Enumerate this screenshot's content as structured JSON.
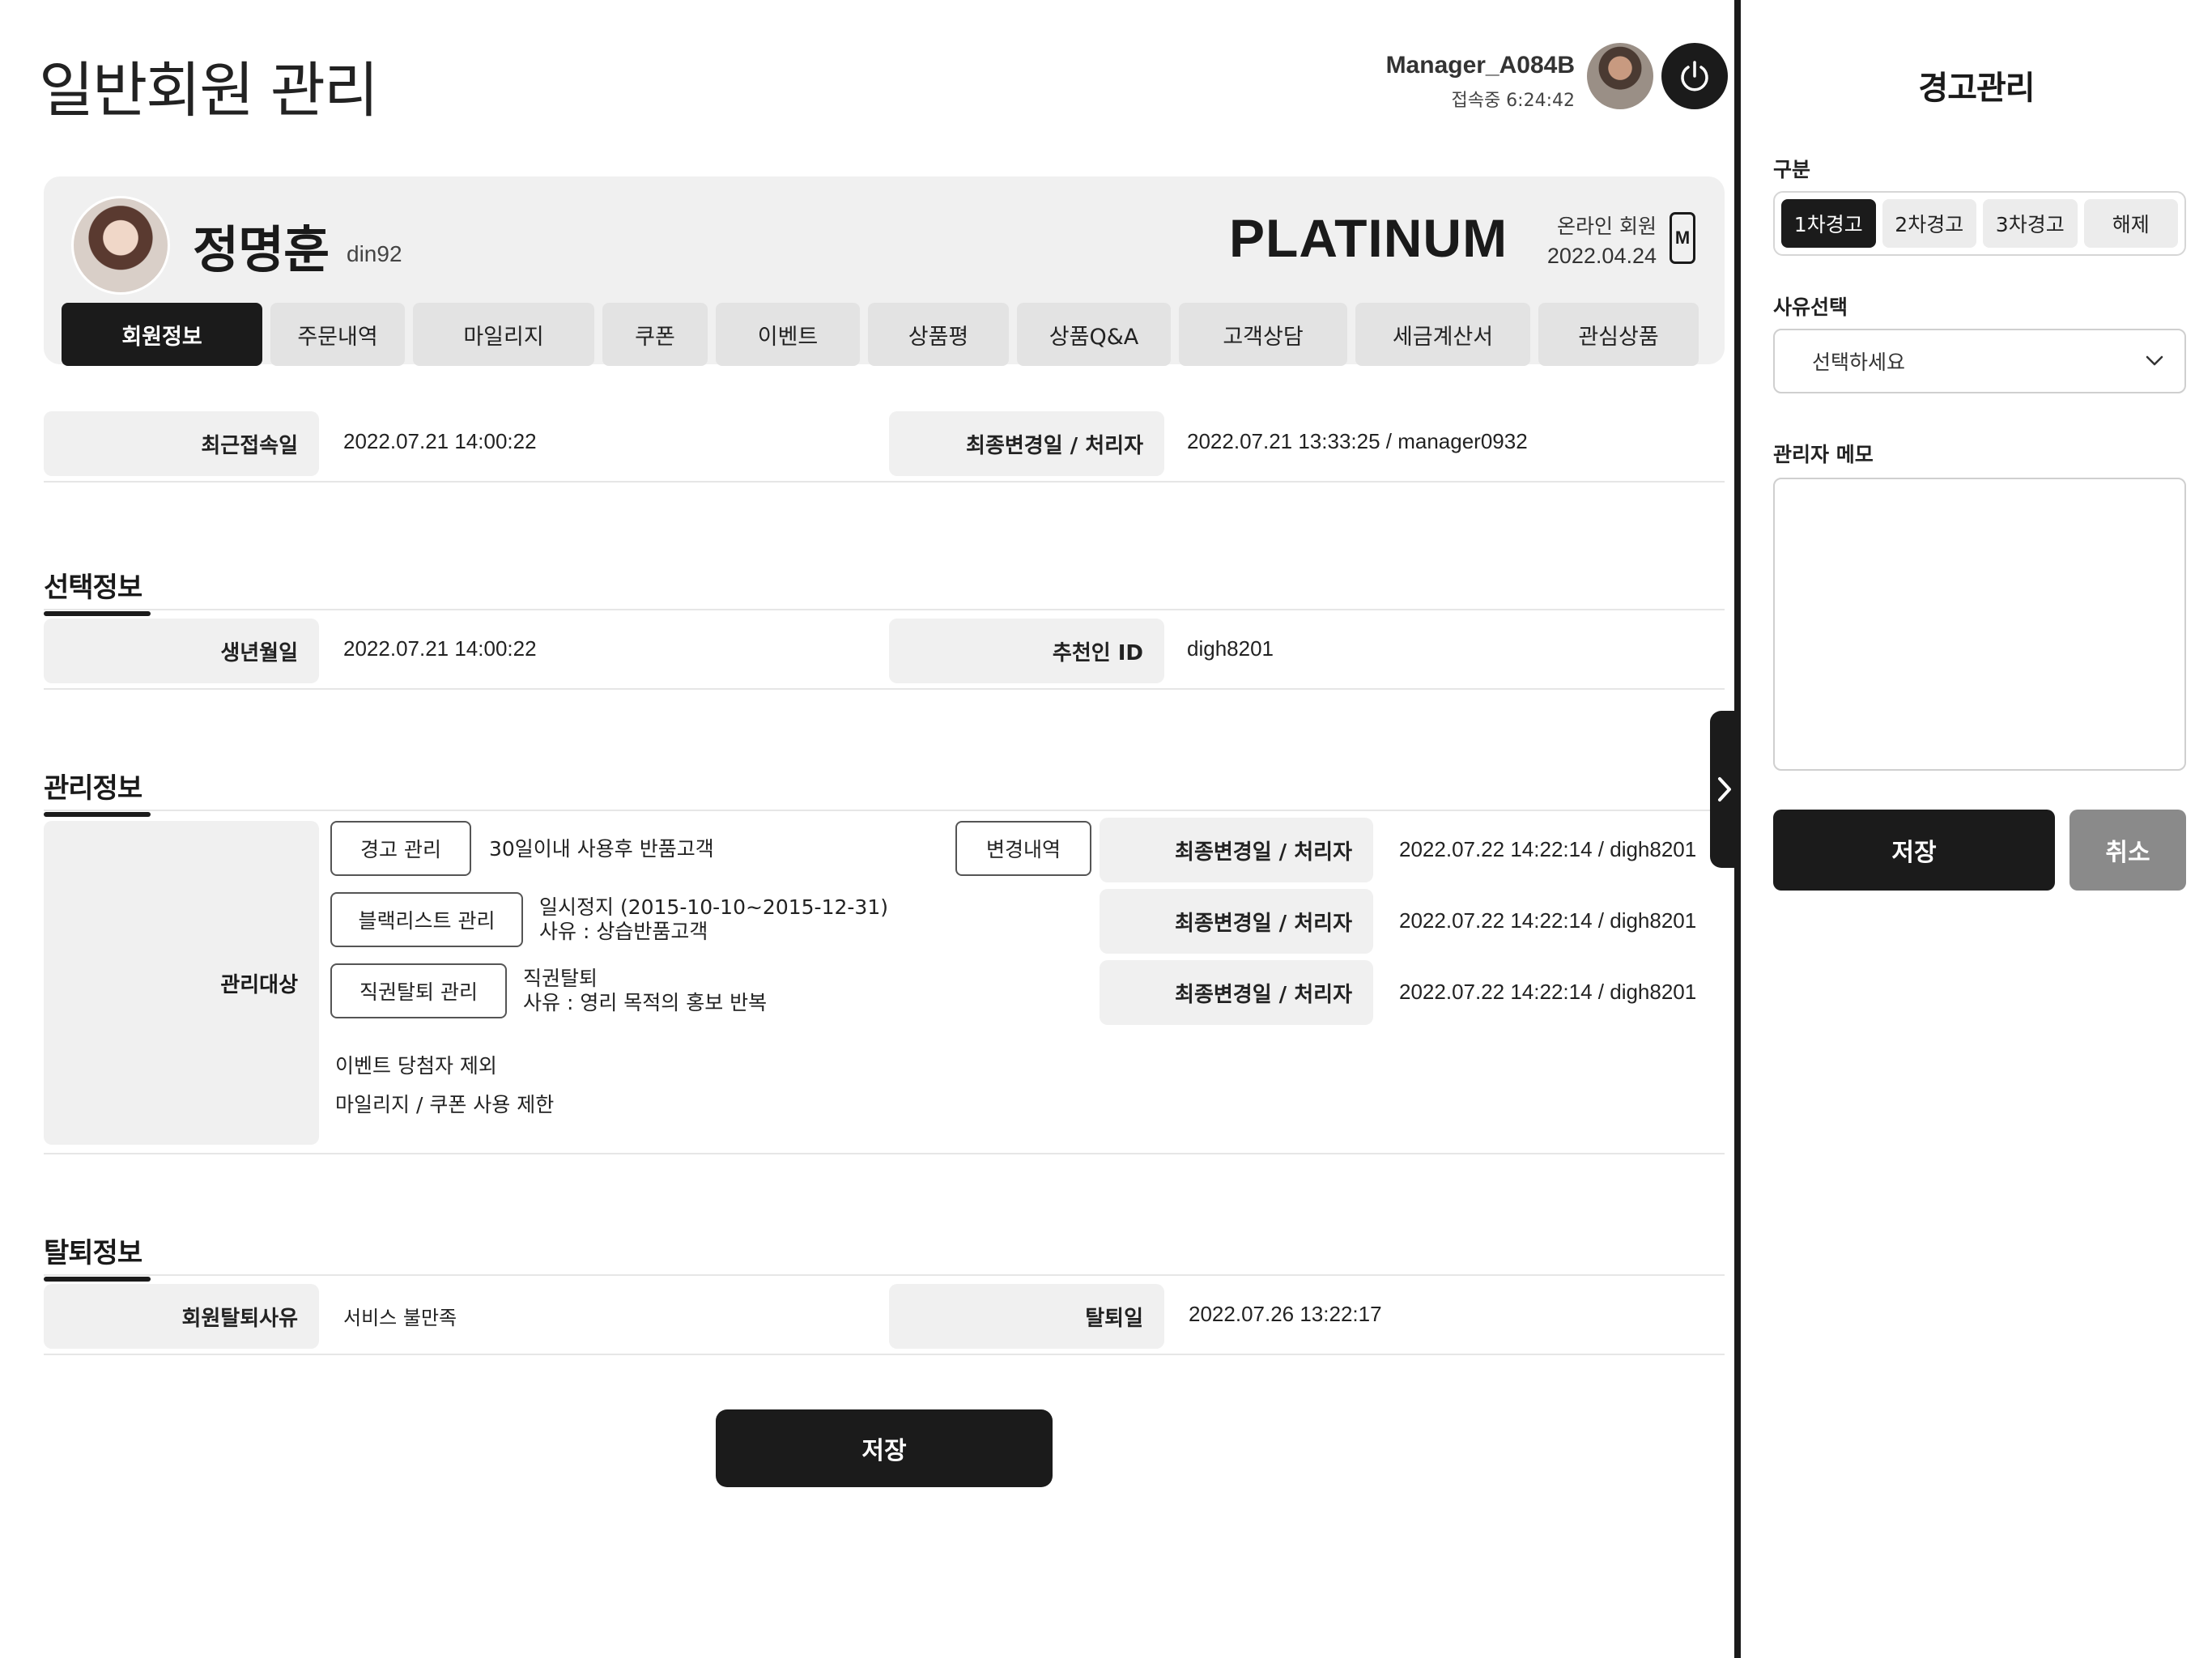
{
  "header": {
    "title": "일반회원 관리",
    "manager_name": "Manager_A084B",
    "manager_status": "접속중 6:24:42"
  },
  "member": {
    "name": "정명훈",
    "id": "din92",
    "grade": "PLATINUM",
    "type": "온라인 회원",
    "join_date": "2022.04.24",
    "device_badge": "M"
  },
  "tabs": [
    {
      "label": "회원정보",
      "active": true
    },
    {
      "label": "주문내역"
    },
    {
      "label": "마일리지"
    },
    {
      "label": "쿠폰"
    },
    {
      "label": "이벤트"
    },
    {
      "label": "상품평"
    },
    {
      "label": "상품Q&A"
    },
    {
      "label": "고객상담"
    },
    {
      "label": "세금계산서"
    },
    {
      "label": "관심상품"
    }
  ],
  "basic": {
    "last_login_label": "최근접속일",
    "last_login_value": "2022.07.21 14:00:22",
    "last_change_label": "최종변경일 / 처리자",
    "last_change_value": "2022.07.21 13:33:25 / manager0932"
  },
  "optional": {
    "title": "선택정보",
    "birthday_label": "생년월일",
    "birthday_value": "2022.07.21 14:00:22",
    "referrer_label": "추천인 ID",
    "referrer_value": "digh8201"
  },
  "management": {
    "title": "관리정보",
    "target_label": "관리대상",
    "warning_button": "경고 관리",
    "warning_text": "30일이내 사용후 반품고객",
    "history_button": "변경내역",
    "blacklist_button": "블랙리스트 관리",
    "blacklist_text1": "일시정지 (2015-10-10~2015-12-31)",
    "blacklist_text2": "사유 : 상습반품고객",
    "withdraw_button": "직권탈퇴 관리",
    "withdraw_text1": "직권탈퇴",
    "withdraw_text2": "사유 : 영리 목적의 홍보 반복",
    "restrict1": "이벤트 당첨자 제외",
    "restrict2": "마일리지 / 쿠폰 사용 제한",
    "change_label": "최종변경일 / 처리자",
    "change_values": [
      "2022.07.22 14:22:14 / digh8201",
      "2022.07.22 14:22:14 / digh8201",
      "2022.07.22 14:22:14 / digh8201"
    ]
  },
  "withdrawal": {
    "title": "탈퇴정보",
    "reason_label": "회원탈퇴사유",
    "reason_value": "서비스 불만족",
    "date_label": "탈퇴일",
    "date_value": "2022.07.26 13:22:17"
  },
  "save_label": "저장",
  "side_panel": {
    "title": "경고관리",
    "type_label": "구분",
    "options": [
      "1차경고",
      "2차경고",
      "3차경고",
      "해제"
    ],
    "selected_option": "1차경고",
    "reason_label": "사유선택",
    "reason_placeholder": "선택하세요",
    "memo_label": "관리자 메모",
    "save_label": "저장",
    "cancel_label": "취소"
  },
  "colors": {
    "primary_dark": "#1b1b1b",
    "label_bg": "#f0f0f0",
    "cancel_gray": "#8a8a8a"
  }
}
